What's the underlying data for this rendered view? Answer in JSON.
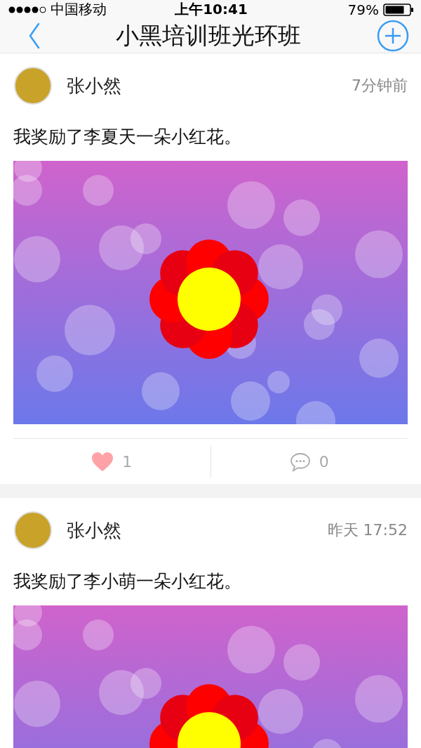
{
  "status_bar": {
    "carrier": "中国移动",
    "time": "上午10:41",
    "battery": "79%"
  },
  "nav": {
    "title": "小黑培训班光环班"
  },
  "posts": [
    {
      "author": "张小然",
      "time": "7分钟前",
      "text": "我奖励了李夏天一朵小红花。",
      "likes": "1",
      "comments": "0"
    },
    {
      "author": "张小然",
      "time": "昨天 17:52",
      "text": "我奖励了李小萌一朵小红花。"
    }
  ]
}
